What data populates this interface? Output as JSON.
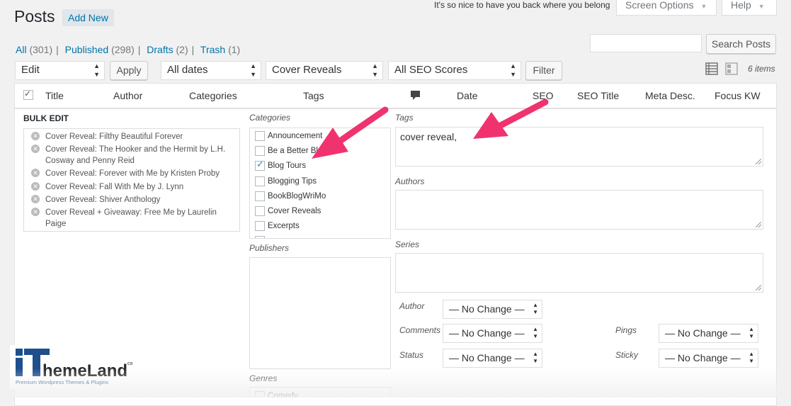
{
  "header": {
    "title": "Posts",
    "add_new": "Add New",
    "notice": "It's so nice to have you back where you belong",
    "screen_options": "Screen Options",
    "help": "Help"
  },
  "views": [
    {
      "label": "All",
      "count": "(301)"
    },
    {
      "label": "Published",
      "count": "(298)"
    },
    {
      "label": "Drafts",
      "count": "(2)"
    },
    {
      "label": "Trash",
      "count": "(1)"
    }
  ],
  "search": {
    "button": "Search Posts",
    "value": ""
  },
  "filters": {
    "bulk_action": "Edit",
    "apply": "Apply",
    "dates": "All dates",
    "category": "Cover Reveals",
    "seo_scores": "All SEO Scores",
    "filter": "Filter",
    "items_count": "6 items"
  },
  "columns": [
    "Title",
    "Author",
    "Categories",
    "Tags",
    "Date",
    "SEO",
    "SEO Title",
    "Meta Desc.",
    "Focus KW"
  ],
  "bulk_edit": {
    "title": "BULK EDIT",
    "posts": [
      "Cover Reveal: Filthy Beautiful Forever",
      "Cover Reveal: The Hooker and the Hermit by L.H. Cosway and Penny Reid",
      "Cover Reveal: Forever with Me by Kristen Proby",
      "Cover Reveal: Fall With Me by J. Lynn",
      "Cover Reveal: Shiver Anthology",
      "Cover Reveal + Giveaway: Free Me by Laurelin Paige"
    ]
  },
  "categories": {
    "label": "Categories",
    "items": [
      {
        "label": "Announcement",
        "checked": false
      },
      {
        "label": "Be a Better Bl",
        "checked": false
      },
      {
        "label": "Blog Tours",
        "checked": true
      },
      {
        "label": "Blogging Tips",
        "checked": false
      },
      {
        "label": "BookBlogWriMo",
        "checked": false
      },
      {
        "label": "Cover Reveals",
        "checked": false
      },
      {
        "label": "Excerpts",
        "checked": false
      }
    ]
  },
  "publishers": {
    "label": "Publishers"
  },
  "genres": {
    "label": "Genres",
    "first": "Comedy"
  },
  "tags": {
    "label": "Tags",
    "value": "cover reveal,"
  },
  "authors": {
    "label": "Authors",
    "value": ""
  },
  "series": {
    "label": "Series",
    "value": ""
  },
  "fields": {
    "author": {
      "label": "Author",
      "value": "— No Change —"
    },
    "comments": {
      "label": "Comments",
      "value": "— No Change —"
    },
    "status": {
      "label": "Status",
      "value": "— No Change —"
    },
    "pings": {
      "label": "Pings",
      "value": "— No Change —"
    },
    "sticky": {
      "label": "Sticky",
      "value": "— No Change —"
    }
  },
  "watermark": {
    "brand": "ThemeLand",
    "tagline": "Premium Wordpress Themes & Plugins"
  },
  "colors": {
    "link": "#0073aa",
    "arrow": "#f0336e",
    "check": "#1e8cbe"
  }
}
